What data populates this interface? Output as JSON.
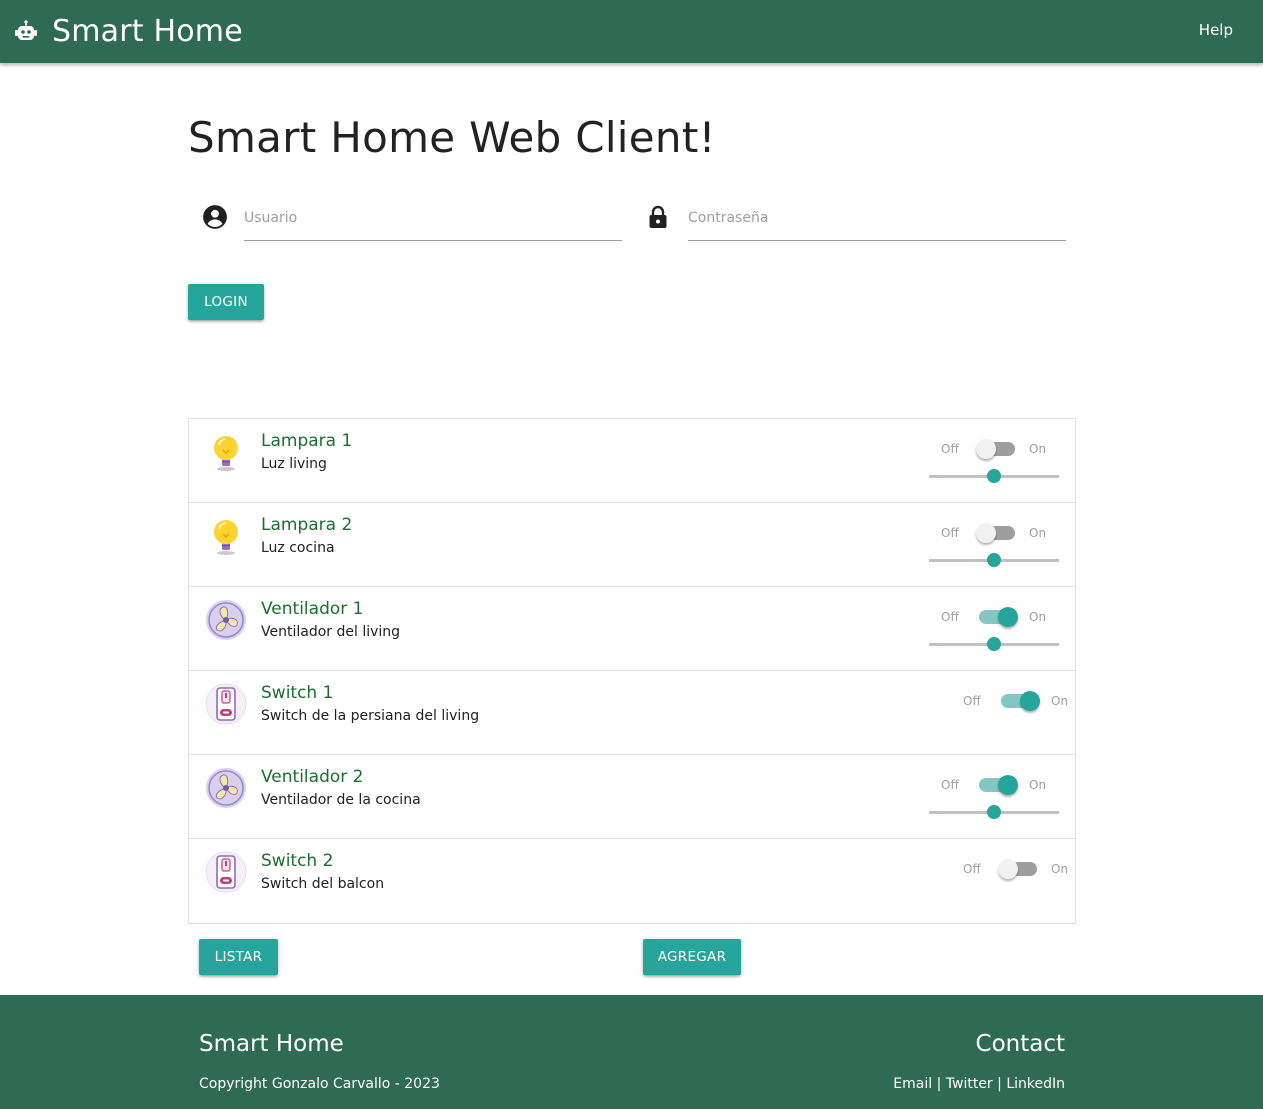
{
  "header": {
    "brand_icon": "robot-icon",
    "title": "Smart Home",
    "help_label": "Help",
    "background": "#2f6a55"
  },
  "main": {
    "page_title": "Smart Home Web Client!",
    "user_field": {
      "icon": "account-circle-icon",
      "placeholder": "Usuario",
      "value": ""
    },
    "password_field": {
      "icon": "lock-icon",
      "placeholder": "Contraseña",
      "value": ""
    },
    "login_label": "Login"
  },
  "devices": [
    {
      "name": "Lampara 1",
      "description": "Luz living",
      "icon": "lightbulb-icon",
      "switch_off_label": "Off",
      "switch_on_label": "On",
      "state": false,
      "has_slider": true,
      "slider_value": 0.5
    },
    {
      "name": "Lampara 2",
      "description": "Luz cocina",
      "icon": "lightbulb-icon",
      "switch_off_label": "Off",
      "switch_on_label": "On",
      "state": false,
      "has_slider": true,
      "slider_value": 0.5
    },
    {
      "name": "Ventilador 1",
      "description": "Ventilador del living",
      "icon": "fan-icon",
      "switch_off_label": "Off",
      "switch_on_label": "On",
      "state": true,
      "has_slider": true,
      "slider_value": 0.5
    },
    {
      "name": "Switch 1",
      "description": "Switch de la persiana del living",
      "icon": "wall-switch-icon",
      "switch_off_label": "Off",
      "switch_on_label": "On",
      "state": true,
      "has_slider": false
    },
    {
      "name": "Ventilador 2",
      "description": "Ventilador de la cocina",
      "icon": "fan-icon",
      "switch_off_label": "Off",
      "switch_on_label": "On",
      "state": true,
      "has_slider": true,
      "slider_value": 0.5
    },
    {
      "name": "Switch 2",
      "description": "Switch del balcon",
      "icon": "wall-switch-icon",
      "switch_off_label": "Off",
      "switch_on_label": "On",
      "state": false,
      "has_slider": false
    }
  ],
  "actions": {
    "list_label": "Listar",
    "add_label": "Agregar",
    "accent": "#26a69a"
  },
  "footer": {
    "title": "Smart Home",
    "copyright": "Copyright Gonzalo Carvallo - 2023",
    "contact_title": "Contact",
    "links": [
      "Email",
      "Twitter",
      "LinkedIn"
    ],
    "separator": " | "
  }
}
